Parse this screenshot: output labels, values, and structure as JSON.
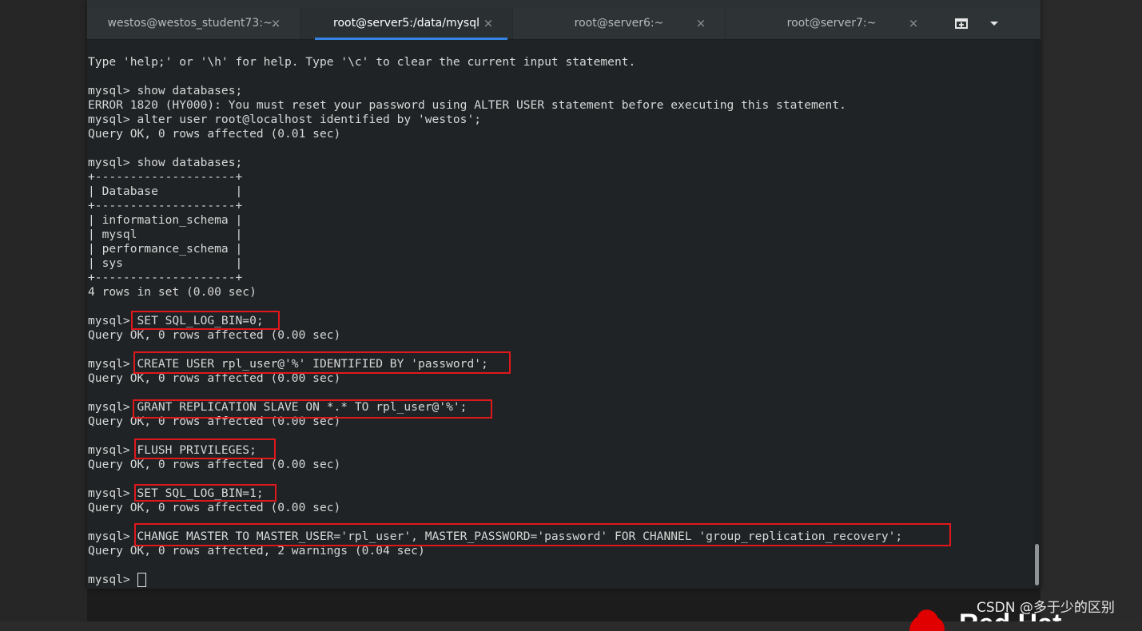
{
  "tabs": [
    {
      "label": "westos@westos_student73:~...",
      "active": false
    },
    {
      "label": "root@server5:/data/mysql",
      "active": true
    },
    {
      "label": "root@server6:~",
      "active": false
    },
    {
      "label": "root@server7:~",
      "active": false
    }
  ],
  "tab_close_glyph": "×",
  "terminal_lines": [
    "Type 'help;' or '\\h' for help. Type '\\c' to clear the current input statement.",
    "",
    "mysql> show databases;",
    "ERROR 1820 (HY000): You must reset your password using ALTER USER statement before executing this statement.",
    "mysql> alter user root@localhost identified by 'westos';",
    "Query OK, 0 rows affected (0.01 sec)",
    "",
    "mysql> show databases;",
    "+--------------------+",
    "| Database           |",
    "+--------------------+",
    "| information_schema |",
    "| mysql              |",
    "| performance_schema |",
    "| sys                |",
    "+--------------------+",
    "4 rows in set (0.00 sec)",
    "",
    "mysql> SET SQL_LOG_BIN=0;",
    "Query OK, 0 rows affected (0.00 sec)",
    "",
    "mysql> CREATE USER rpl_user@'%' IDENTIFIED BY 'password';",
    "Query OK, 0 rows affected (0.00 sec)",
    "",
    "mysql> GRANT REPLICATION SLAVE ON *.* TO rpl_user@'%';",
    "Query OK, 0 rows affected (0.00 sec)",
    "",
    "mysql> FLUSH PRIVILEGES;",
    "Query OK, 0 rows affected (0.00 sec)",
    "",
    "mysql> SET SQL_LOG_BIN=1;",
    "Query OK, 0 rows affected (0.00 sec)",
    "",
    "mysql> CHANGE MASTER TO MASTER_USER='rpl_user', MASTER_PASSWORD='password' FOR CHANNEL 'group_replication_recovery';",
    "Query OK, 0 rows affected, 2 warnings (0.04 sec)",
    "",
    "mysql> "
  ],
  "watermark": "CSDN @多于少的区别",
  "brand_text": "Red Hat",
  "colors": {
    "terminal_bg": "#1f2325",
    "terminal_fg": "#d7d7d7",
    "active_tab_accent": "#3584e4",
    "highlight_box": "#e0181c"
  }
}
